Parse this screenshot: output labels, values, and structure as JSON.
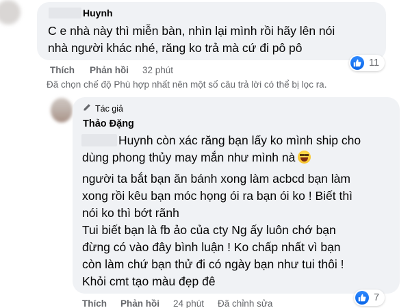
{
  "comment1": {
    "author": "Huynh",
    "text_lines": [
      "C e nhà này thì miễn bàn, nhìn lại mình rồi hãy lên nói",
      "nhà người khác nhé, răng ko trả mà cứ đi pô pô"
    ],
    "like_label": "Thích",
    "reply_label": "Phản hồi",
    "time": "32 phút",
    "reaction_count": "11"
  },
  "notice": "Đã chọn chế độ Phù hợp nhất nên một số câu trả lời có thể bị lọc ra.",
  "comment2": {
    "badge": "Tác giả",
    "author": "Thảo Đặng",
    "mention_tail": "Huynh còn xác răng bạn lấy ko mình ship cho",
    "line2": "dùng phong thủy may mắn như mình nà",
    "paragraph2": [
      "người ta bắt bạn ăn bánh xong làm acbcd bạn làm",
      "xong rồi kêu bạn móc họng ói ra bạn ói ko ! Biết thì",
      "nói ko thì bớt rãnh",
      "Tui biết bạn là fb ảo của cty Ng ấy luôn chớ bạn",
      "đừng có vào đây bình luận ! Ko chấp nhất vì bạn",
      "còn làm chứ bạn thử đi có ngày bạn như tui thôi !",
      "Khỏi cmt tạo màu đẹp đê"
    ],
    "like_label": "Thích",
    "reply_label": "Phản hồi",
    "time": "24 phút",
    "edited": "Đã chỉnh sửa",
    "reaction_count": "7"
  },
  "colors": {
    "bubble": "#f0f2f5",
    "meta_text": "#65676b",
    "like_blue": "#1877f2"
  },
  "icons": [
    "like-icon",
    "pencil-icon",
    "laughing-emoji-icon"
  ]
}
